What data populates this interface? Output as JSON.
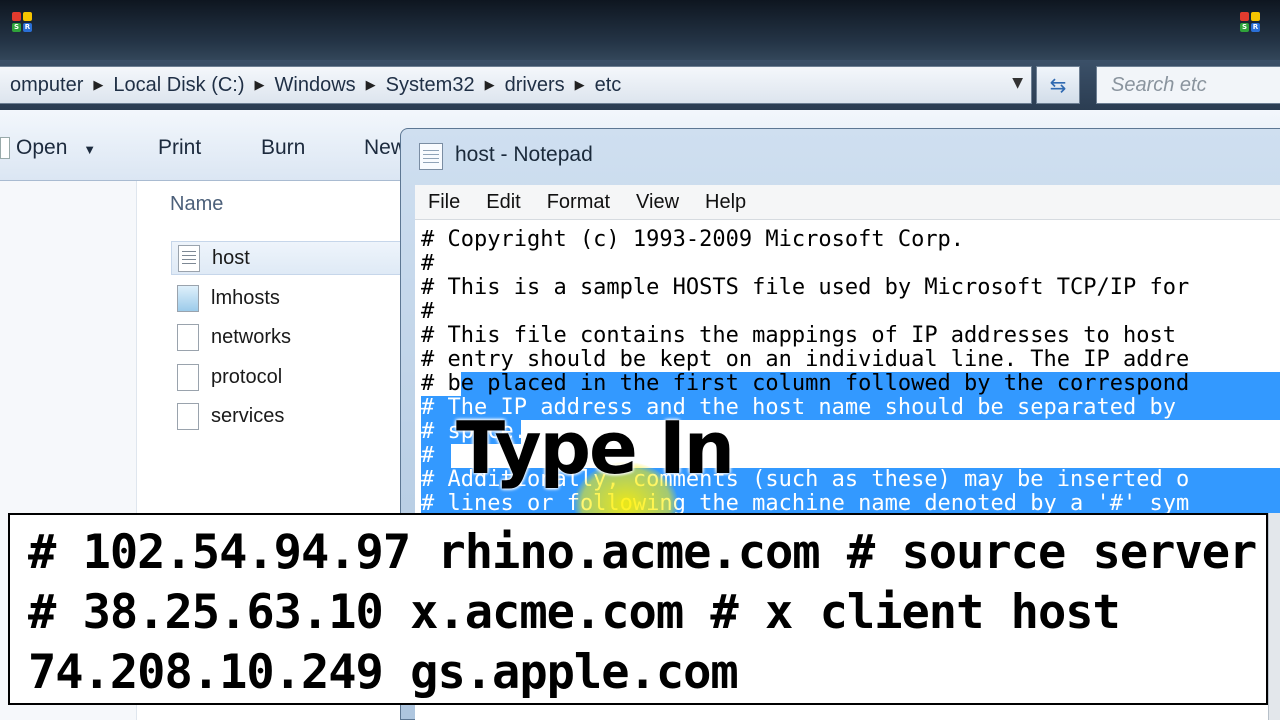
{
  "explorer": {
    "breadcrumb": [
      "omputer",
      "Local Disk (C:)",
      "Windows",
      "System32",
      "drivers",
      "etc"
    ],
    "search_placeholder": "Search etc",
    "toolbar": {
      "open": "Open",
      "print": "Print",
      "burn": "Burn",
      "new": "New"
    },
    "column_header": "Name",
    "files": [
      {
        "name": "host",
        "icon": "text-file-icon",
        "selected": true
      },
      {
        "name": "lmhosts",
        "icon": "app-file-icon",
        "selected": false
      },
      {
        "name": "networks",
        "icon": "blank-file-icon",
        "selected": false
      },
      {
        "name": "protocol",
        "icon": "blank-file-icon",
        "selected": false
      },
      {
        "name": "services",
        "icon": "blank-file-icon",
        "selected": false
      }
    ]
  },
  "notepad": {
    "title": "host - Notepad",
    "menu": [
      "File",
      "Edit",
      "Format",
      "View",
      "Help"
    ],
    "lines": [
      "# Copyright (c) 1993-2009 Microsoft Corp.",
      "#",
      "# This is a sample HOSTS file used by Microsoft TCP/IP for",
      "#",
      "# This file contains the mappings of IP addresses to host",
      "# entry should be kept on an individual line. The IP addre",
      "# be placed in the first column followed by the correspond",
      "# The IP address and the host name should be separated by",
      "# space.",
      "#",
      "# Additionally, comments (such as these) may be inserted o",
      "# lines or following the machine name denoted by a '#' sym"
    ],
    "selection_color": "#3399ff"
  },
  "overlay": {
    "heading": "Type In",
    "caption_lines": [
      "# 102.54.94.97 rhino.acme.com # source server",
      "# 38.25.63.10 x.acme.com # x client host",
      "74.208.10.249 gs.apple.com"
    ]
  }
}
